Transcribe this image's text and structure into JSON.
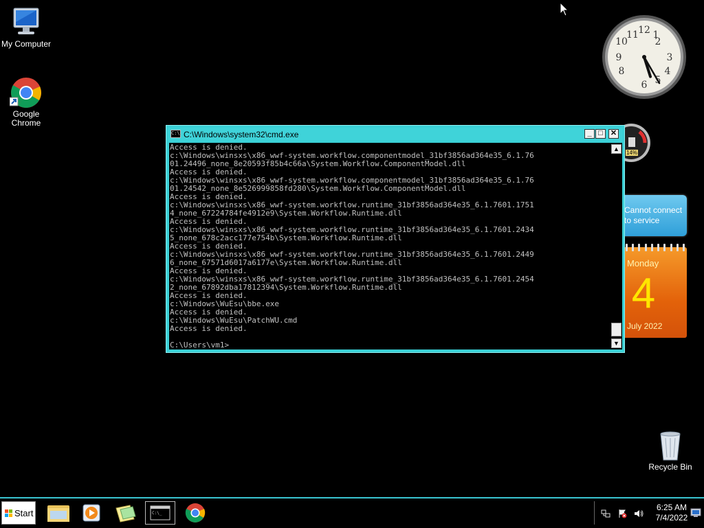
{
  "desktop": {
    "icons": [
      {
        "label": "My Computer",
        "icon": "computer-icon"
      },
      {
        "label": "Google Chrome",
        "icon": "chrome-icon"
      },
      {
        "label": "Recycle Bin",
        "icon": "recycle-bin-icon"
      }
    ],
    "gadgets": {
      "clock": {
        "hour": 5,
        "minute": 25,
        "icon": "analog-clock"
      },
      "cpu_meter": {
        "percent_label": "14%"
      },
      "weather": {
        "text": "Cannot connect\nto service"
      },
      "calendar": {
        "weekday": "Monday",
        "day": "4",
        "month_year": "July 2022"
      }
    }
  },
  "cmd_window": {
    "title": "C:\\Windows\\system32\\cmd.exe",
    "icon_text": "C:\\",
    "buttons": {
      "minimize": "_",
      "maximize": "□",
      "close": "✕"
    },
    "lines": [
      "Access is denied.",
      "c:\\Windows\\winsxs\\x86_wwf-system.workflow.componentmodel_31bf3856ad364e35_6.1.76",
      "01.24496_none_8e20593f85b4c66a\\System.Workflow.ComponentModel.dll",
      "Access is denied.",
      "c:\\Windows\\winsxs\\x86_wwf-system.workflow.componentmodel_31bf3856ad364e35_6.1.76",
      "01.24542_none_8e526999858fd280\\System.Workflow.ComponentModel.dll",
      "Access is denied.",
      "c:\\Windows\\winsxs\\x86_wwf-system.workflow.runtime_31bf3856ad364e35_6.1.7601.1751",
      "4_none_67224784fe4912e9\\System.Workflow.Runtime.dll",
      "Access is denied.",
      "c:\\Windows\\winsxs\\x86_wwf-system.workflow.runtime_31bf3856ad364e35_6.1.7601.2434",
      "5_none_678c2acc177e754b\\System.Workflow.Runtime.dll",
      "Access is denied.",
      "c:\\Windows\\winsxs\\x86_wwf-system.workflow.runtime_31bf3856ad364e35_6.1.7601.2449",
      "6_none_67571d6017a6177e\\System.Workflow.Runtime.dll",
      "Access is denied.",
      "c:\\Windows\\winsxs\\x86_wwf-system.workflow.runtime_31bf3856ad364e35_6.1.7601.2454",
      "2_none_67892dba17812394\\System.Workflow.Runtime.dll",
      "Access is denied.",
      "c:\\Windows\\WuEsu\\bbe.exe",
      "Access is denied.",
      "c:\\Windows\\WuEsu\\PatchWU.cmd",
      "Access is denied.",
      "",
      "C:\\Users\\vm1>"
    ]
  },
  "taskbar": {
    "start_label": "Start",
    "apps": [
      {
        "name": "explorer-icon",
        "active": false
      },
      {
        "name": "media-player-icon",
        "active": false
      },
      {
        "name": "sticky-notes-icon",
        "active": false
      },
      {
        "name": "cmd-icon",
        "active": true
      },
      {
        "name": "chrome-icon",
        "active": false
      }
    ],
    "tray": {
      "time": "6:25 AM",
      "date": "7/4/2022",
      "icons": [
        "network-icon",
        "action-center-icon",
        "volume-icon",
        "show-desktop-icon"
      ]
    }
  },
  "colors": {
    "accent": "#3ad0d6",
    "console_text": "#c0c0c0"
  }
}
